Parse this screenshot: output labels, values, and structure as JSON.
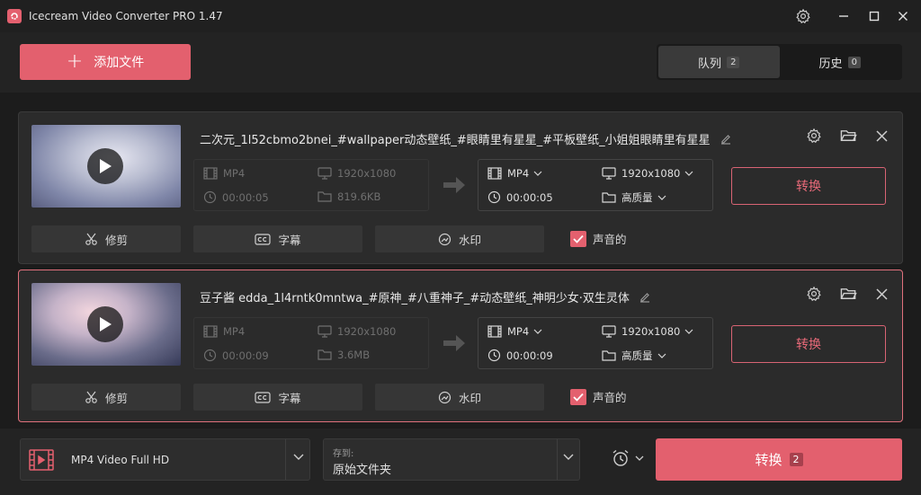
{
  "app": {
    "title": "Icecream Video Converter PRO 1.47"
  },
  "toolbar": {
    "add_file_label": "添加文件"
  },
  "tabs": [
    {
      "label": "队列",
      "count": "2",
      "active": true
    },
    {
      "label": "历史",
      "count": "0",
      "active": false
    }
  ],
  "files": [
    {
      "filename": "二次元_1l52cbmo2bnei_#wallpaper动态壁纸_#眼睛里有星星_#平板壁纸_小姐姐眼睛里有星星",
      "source": {
        "format": "MP4",
        "resolution": "1920x1080",
        "duration": "00:00:05",
        "size": "819.6KB"
      },
      "output": {
        "format": "MP4",
        "resolution": "1920x1080",
        "duration": "00:00:05",
        "quality": "高质量"
      },
      "convert_label": "转换",
      "actions": {
        "trim": "修剪",
        "subtitles": "字幕",
        "watermark": "水印"
      },
      "audio_label": "声音的",
      "audio_checked": true
    },
    {
      "filename": "豆子酱 edda_1l4rntk0mntwa_#原神_#八重神子_#动态壁纸_神明少女·双生灵体",
      "source": {
        "format": "MP4",
        "resolution": "1920x1080",
        "duration": "00:00:09",
        "size": "3.6MB"
      },
      "output": {
        "format": "MP4",
        "resolution": "1920x1080",
        "duration": "00:00:09",
        "quality": "高质量"
      },
      "convert_label": "转换",
      "actions": {
        "trim": "修剪",
        "subtitles": "字幕",
        "watermark": "水印"
      },
      "audio_label": "声音的",
      "audio_checked": true
    }
  ],
  "bottom": {
    "preset_label": "MP4 Video Full HD",
    "save_to_label": "存到:",
    "save_to_value": "原始文件夹",
    "convert_all_label": "转换",
    "convert_all_count": "2"
  },
  "colors": {
    "accent": "#e3606e",
    "background": "#232323",
    "card": "#2b2b2b"
  }
}
